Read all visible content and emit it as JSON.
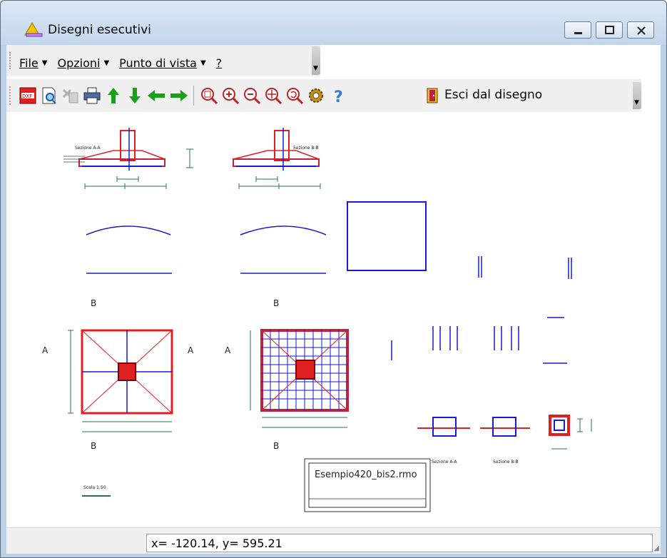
{
  "window": {
    "title": "Disegni esecutivi"
  },
  "menu": {
    "items": [
      {
        "label": "File",
        "has_arrow": true
      },
      {
        "label": "Opzioni",
        "has_arrow": true
      },
      {
        "label": "Punto di vista",
        "has_arrow": true
      },
      {
        "label": "?",
        "has_arrow": false
      }
    ]
  },
  "toolbar": {
    "buttons": [
      "dxf-export-icon",
      "print-preview-icon",
      "disabled-tool-icon",
      "printer-icon",
      "arrow-up-icon",
      "arrow-down-icon",
      "arrow-left-icon",
      "arrow-right-icon",
      "zoom-window-icon",
      "zoom-in-icon",
      "zoom-out-icon",
      "zoom-extents-icon",
      "zoom-previous-icon",
      "settings-gear-icon",
      "help-icon",
      "exit-door-icon"
    ],
    "exit_label": "Esci dal disegno"
  },
  "drawing": {
    "section_a_label": "Sezione A-A",
    "section_b_label": "Sezione B-B",
    "marker_a": "A",
    "marker_b": "B",
    "title_block": "Esempio420_bis2.rmo",
    "scale_label": "Scala 1:50"
  },
  "status": {
    "coordinates": "x= -120.14, y= 595.21"
  },
  "colors": {
    "accent_red": "#e02020",
    "accent_blue": "#1a1ad0",
    "dim_green": "#207848"
  }
}
